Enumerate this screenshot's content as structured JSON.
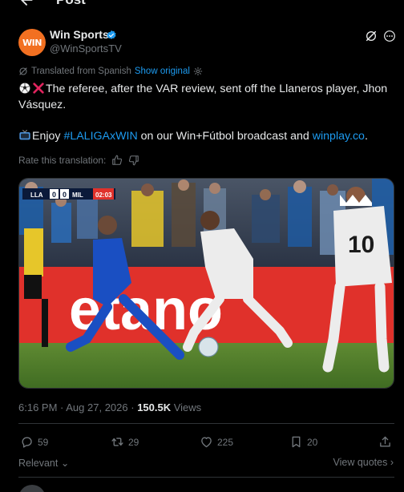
{
  "header": {
    "title": "Post",
    "back_icon": "arrow-left-icon"
  },
  "author": {
    "avatar_text": "WIN",
    "display_name": "Win Sports",
    "handle": "@WinSportsTV",
    "verified": true,
    "brand_color": "#f27021",
    "verified_color": "#1d9bf0"
  },
  "translation": {
    "notice": "Translated from Spanish",
    "show_original": "Show original",
    "rate_prompt": "Rate this translation:"
  },
  "tweet": {
    "line1": "The referee, after the VAR review, sent off the Llaneros player, Jhon",
    "line2": "Vásquez.",
    "line3_prefix": "Enjoy ",
    "hashtag": "#LALIGAxWIN",
    "line3_middle": " on our Win+Fútbol broadcast and ",
    "link": "winplay.co",
    "line3_suffix": "."
  },
  "media": {
    "scoreboard": {
      "team_home": "LLA",
      "score_home": "0",
      "score_away": "0",
      "team_away": "MIL",
      "clock": "02:03"
    },
    "banner_text": "etano",
    "player_number": "10"
  },
  "meta": {
    "time": "6:16 PM",
    "separator": " · ",
    "date": "Aug 27, 2026",
    "views_count": "150.5K",
    "views_label": " Views"
  },
  "actions": {
    "replies": "59",
    "reposts": "29",
    "likes": "225",
    "bookmarks": "20"
  },
  "footer": {
    "sort_label": "Relevant",
    "view_quotes": "View quotes"
  },
  "colors": {
    "background": "#000000",
    "text": "#e7e9ea",
    "muted": "#71767b",
    "accent": "#1d9bf0",
    "border": "#2f3336"
  }
}
